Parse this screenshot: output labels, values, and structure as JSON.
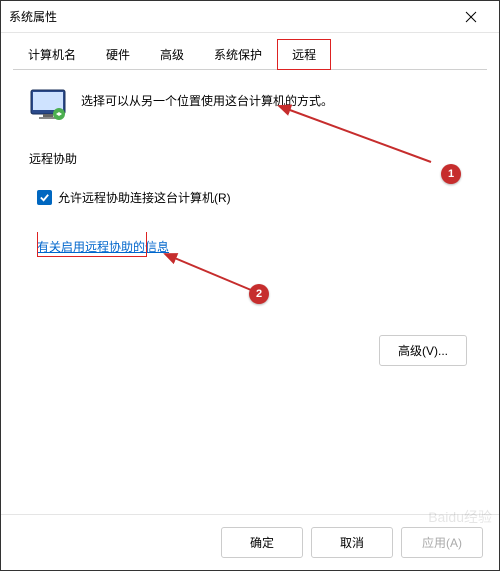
{
  "window": {
    "title": "系统属性"
  },
  "tabs": {
    "items": [
      {
        "label": "计算机名"
      },
      {
        "label": "硬件"
      },
      {
        "label": "高级"
      },
      {
        "label": "系统保护"
      },
      {
        "label": "远程"
      }
    ],
    "active_index": 4,
    "highlighted_index": 4
  },
  "content": {
    "intro_text": "选择可以从另一个位置使用这台计算机的方式。",
    "remote_assist": {
      "group_label": "远程协助",
      "checkbox_checked": true,
      "checkbox_label": "允许远程协助连接这台计算机(R)",
      "info_link": "有关启用远程协助的信息",
      "advanced_button": "高级(V)..."
    }
  },
  "footer": {
    "ok": "确定",
    "cancel": "取消",
    "apply": "应用(A)"
  },
  "annotations": {
    "badge1": "1",
    "badge2": "2"
  },
  "watermark": "Baidu经验"
}
